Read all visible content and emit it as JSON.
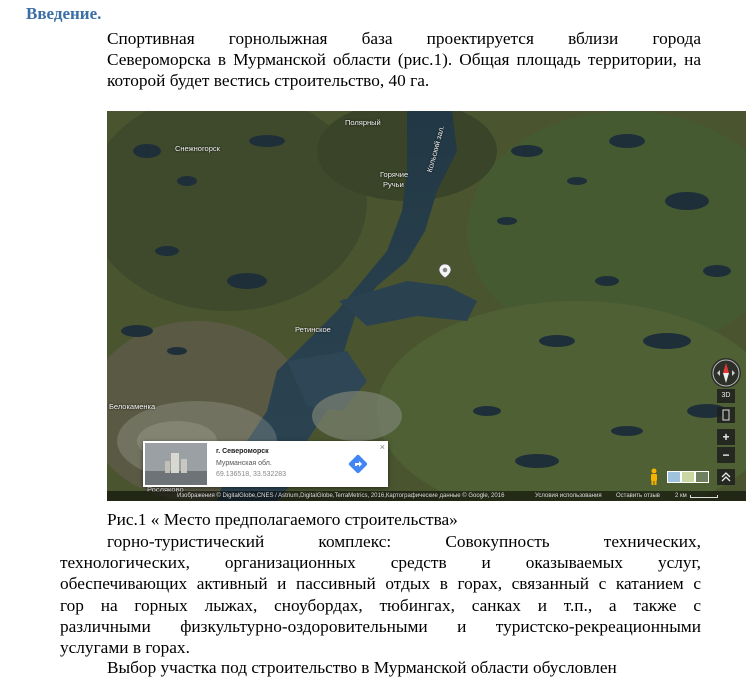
{
  "heading": "Введение.",
  "intro": {
    "line1": "Спортивная горнолыжная база проектируется вблизи города",
    "line2": "Североморска в Мурманской области (рис.1). Общая площадь территории, на",
    "line3": "которой будет вестись строительство,  40 га."
  },
  "map": {
    "labels": {
      "polyarny": "Полярный",
      "snezhnogorsk": "Снежногорск",
      "goryachie": "Горячие",
      "ruchi": "Ручьи",
      "kola_bay": "Кольский зал.",
      "retinskoe": "Ретинское",
      "belokamenka": "Белокаменка",
      "roslyakovo": "Росляково"
    },
    "card": {
      "title": "г. Североморск",
      "region": "Мурманская обл.",
      "coords": "69.136518, 33.532283",
      "close": "×"
    },
    "controls": {
      "view3d": "3D",
      "zoom_in": "+",
      "zoom_out": "−",
      "expand": "⌃⌃"
    },
    "attribution": {
      "imagery": "Изображения © DigitalGlobe,CNES / Astrium,DigitalGlobe,TerraMetrics, 2016,Картографические данные © Google, 2016",
      "terms": "Условия использования",
      "feedback": "Оставить отзыв",
      "scale": "2 км"
    },
    "icons": {
      "compass": "compass-icon",
      "pegman": "pegman-icon",
      "directions": "directions-arrow-icon",
      "marker": "location-marker-icon"
    }
  },
  "caption": "Рис.1 « Место предполагаемого строительства»",
  "para2": {
    "first": "горно-туристический комплекс: Совокупность технических,",
    "line2": "технологических, организационных средств и оказываемых услуг,",
    "line3": "обеспечивающих активный и пассивный отдых в горах, связанный с катанием с",
    "line4": "гор на горных лыжах, сноубордах, тюбингах, санках и т.п., а также с",
    "line5": "различными физкультурно-оздоровительными и туристско-рекреационными",
    "line6": "услугами в горах."
  },
  "para3": "Выбор участка под строительство в Мурманской области обусловлен"
}
